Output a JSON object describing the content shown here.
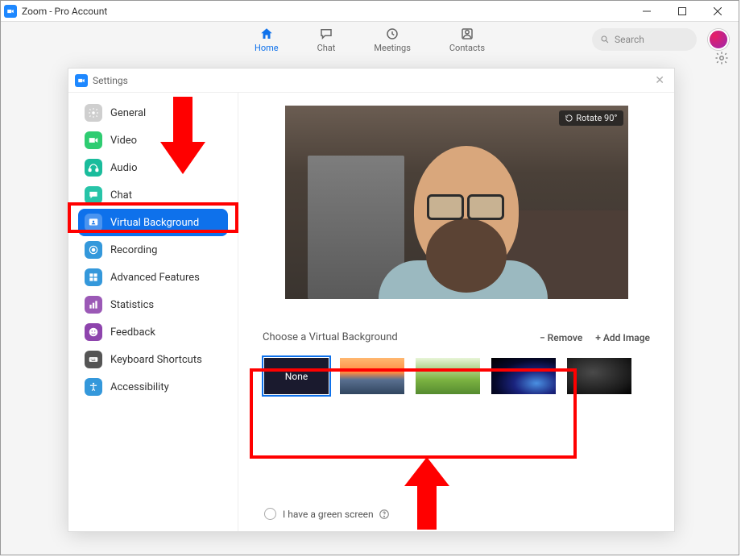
{
  "window": {
    "title": "Zoom - Pro Account"
  },
  "nav": {
    "items": [
      {
        "label": "Home",
        "active": true
      },
      {
        "label": "Chat"
      },
      {
        "label": "Meetings"
      },
      {
        "label": "Contacts"
      }
    ]
  },
  "search": {
    "placeholder": "Search"
  },
  "settings": {
    "title": "Settings",
    "sidebar": [
      {
        "label": "General",
        "icon": "gear",
        "color": "#cfcfcf"
      },
      {
        "label": "Video",
        "icon": "video",
        "color": "#2ecc71"
      },
      {
        "label": "Audio",
        "icon": "audio",
        "color": "#1abc9c"
      },
      {
        "label": "Chat",
        "icon": "chat",
        "color": "#27c4a8"
      },
      {
        "label": "Virtual Background",
        "icon": "vb",
        "color": "#0e71eb",
        "active": true
      },
      {
        "label": "Recording",
        "icon": "rec",
        "color": "#3498db"
      },
      {
        "label": "Advanced Features",
        "icon": "adv",
        "color": "#3498db"
      },
      {
        "label": "Statistics",
        "icon": "stats",
        "color": "#9b59b6"
      },
      {
        "label": "Feedback",
        "icon": "feedback",
        "color": "#8e44ad"
      },
      {
        "label": "Keyboard Shortcuts",
        "icon": "kbd",
        "color": "#555"
      },
      {
        "label": "Accessibility",
        "icon": "acc",
        "color": "#3498db"
      }
    ],
    "rotate_label": "Rotate 90°",
    "section_title": "Choose a Virtual Background",
    "remove_label": "Remove",
    "add_image_label": "Add Image",
    "thumbs": [
      {
        "name": "None",
        "selected": true,
        "kind": "none"
      },
      {
        "kind": "bridge"
      },
      {
        "kind": "grass"
      },
      {
        "kind": "earth"
      },
      {
        "kind": "dark"
      }
    ],
    "greenscreen_label": "I have a green screen"
  }
}
